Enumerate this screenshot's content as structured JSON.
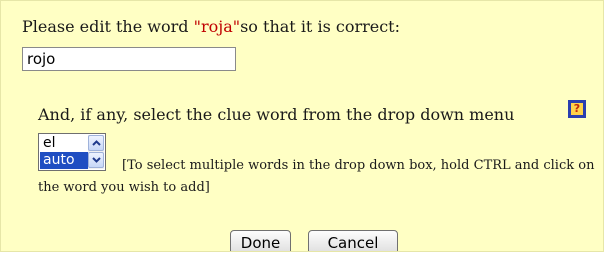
{
  "prompt": {
    "before": "Please edit the word ",
    "word": "\"roja\"",
    "after": "so that it is correct:"
  },
  "answer": {
    "value": "rojo"
  },
  "clue": {
    "prompt": "And, if any, select the clue word from the drop down menu",
    "help_icon_label": "?",
    "options": [
      "el",
      "auto"
    ],
    "selected_option": "auto",
    "instructions": "[To select multiple words in the drop down box, hold CTRL and click on the word you wish to add]"
  },
  "buttons": {
    "done_label": "Done",
    "cancel_label": "Cancel"
  },
  "colors": {
    "panel_background": "#ffffc4",
    "target_word": "#c00000",
    "selection": "#1f4ec2"
  },
  "icons": [
    "help-icon",
    "scroll-up-icon",
    "scroll-down-icon"
  ]
}
